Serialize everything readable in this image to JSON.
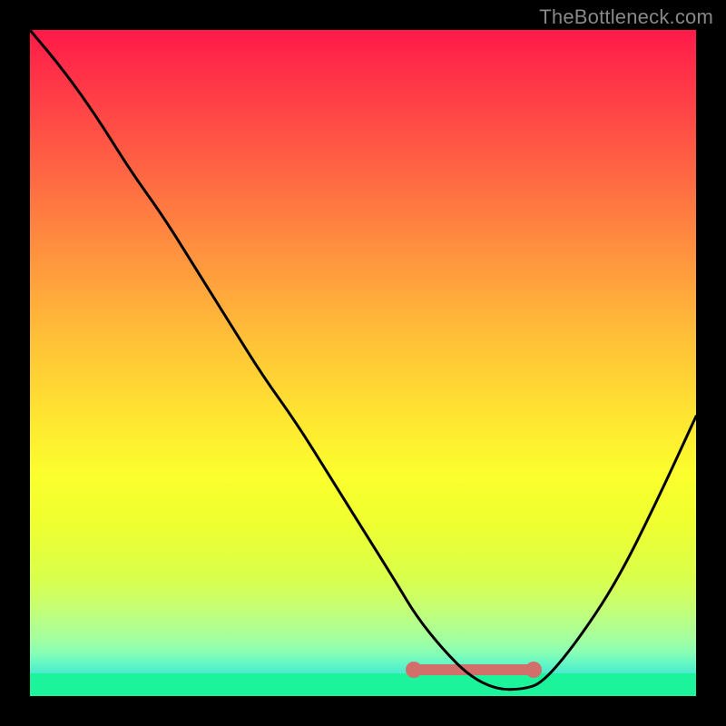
{
  "watermark": "TheBottleneck.com",
  "chart_data": {
    "type": "line",
    "title": "",
    "xlabel": "",
    "ylabel": "",
    "xlim": [
      0,
      100
    ],
    "ylim": [
      0,
      100
    ],
    "x": [
      0,
      5,
      10,
      15,
      20,
      25,
      30,
      35,
      40,
      45,
      50,
      55,
      58,
      62,
      66,
      70,
      74,
      77,
      82,
      88,
      94,
      100
    ],
    "values": [
      100,
      94,
      87,
      79,
      72,
      64,
      56,
      48,
      41,
      33,
      25,
      17,
      12,
      7,
      3,
      1,
      1,
      2,
      8,
      17,
      29,
      42
    ],
    "hump_x_range": [
      58,
      77
    ],
    "background_gradient": [
      "#ff1a49",
      "#ffe531",
      "#1cf49c"
    ]
  }
}
